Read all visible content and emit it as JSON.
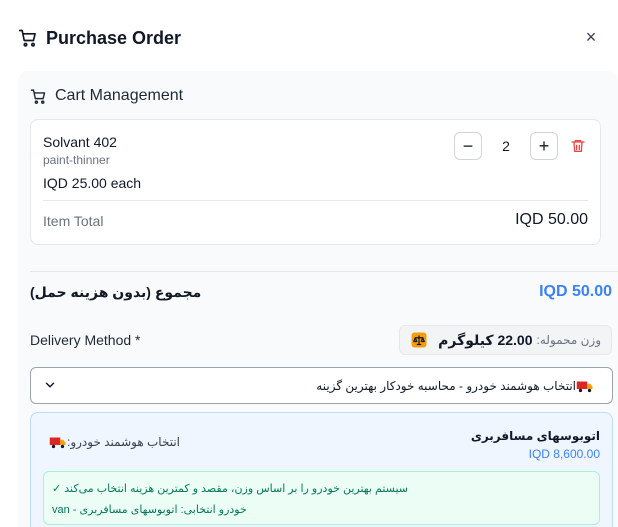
{
  "header": {
    "title": "Purchase Order",
    "close_icon": "×"
  },
  "cart": {
    "title": "Cart Management",
    "item": {
      "name": "Solvant 402",
      "sku": "paint-thinner",
      "price_each": "IQD 25.00 each",
      "quantity": "2",
      "minus": "−",
      "plus": "+",
      "total_label": "Item Total",
      "total_value": "IQD 50.00"
    }
  },
  "summary": {
    "subtotal_label": "مجموع (بدون هزینه حمل)",
    "subtotal_value": "IQD 50.00"
  },
  "delivery": {
    "label": "Delivery Method *",
    "weight_label": "وزن محموله:",
    "weight_value": "22.00 کیلوگرم",
    "select_value": "انتخاب هوشمند خودرو - محاسبه خودکار بهترین گزینه"
  },
  "smart": {
    "left_label": "انتخاب هوشمند خودرو:",
    "right_title": "اتوبوسهای مسافربری",
    "right_price": "IQD 8,600.00",
    "note_line1": "سیستم بهترین خودرو را بر اساس وزن، مقصد و کمترین هزینه انتخاب می‌کند ✓",
    "note_line2": "خودرو انتخابی: اتوبوسهای مسافربری - van"
  },
  "colors": {
    "accent": "#3b82f6",
    "danger": "#ef4444",
    "success": "#047857"
  }
}
